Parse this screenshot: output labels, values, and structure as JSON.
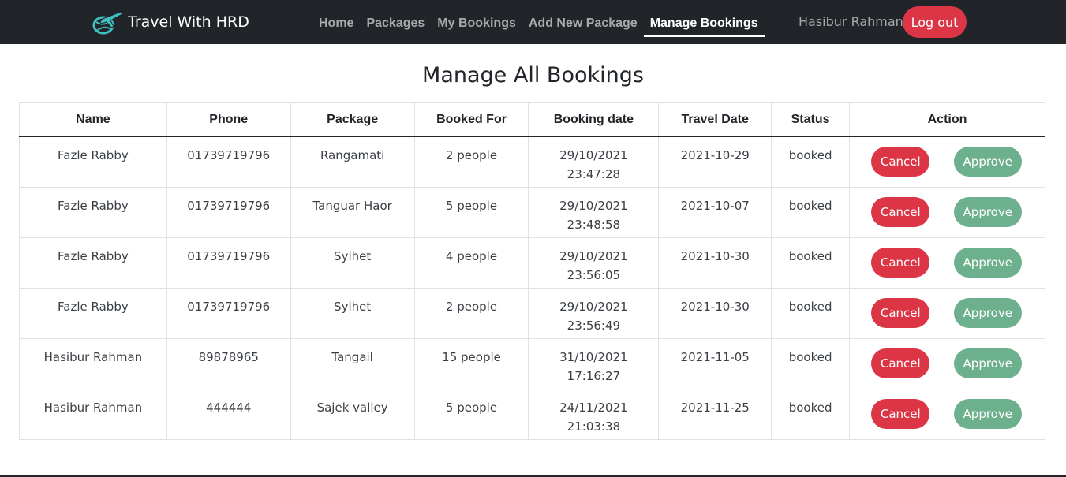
{
  "navbar": {
    "brand": "Travel With HRD",
    "links": [
      {
        "label": "Home"
      },
      {
        "label": "Packages"
      },
      {
        "label": "My Bookings"
      },
      {
        "label": "Add New Package"
      },
      {
        "label": "Manage Bookings",
        "active": true
      }
    ],
    "user_name": "Hasibur Rahman",
    "logout_label": "Log out"
  },
  "page": {
    "title": "Manage All Bookings"
  },
  "table": {
    "headers": [
      "Name",
      "Phone",
      "Package",
      "Booked For",
      "Booking date",
      "Travel Date",
      "Status",
      "Action"
    ],
    "cancel_label": "Cancel",
    "approve_label": "Approve",
    "rows": [
      {
        "name": "Fazle Rabby",
        "phone": "01739719796",
        "package": "Rangamati",
        "booked_for": "2 people",
        "booking_date": "29/10/2021",
        "booking_time": "23:47:28",
        "travel_date": "2021-10-29",
        "status": "booked"
      },
      {
        "name": "Fazle Rabby",
        "phone": "01739719796",
        "package": "Tanguar Haor",
        "booked_for": "5 people",
        "booking_date": "29/10/2021",
        "booking_time": "23:48:58",
        "travel_date": "2021-10-07",
        "status": "booked"
      },
      {
        "name": "Fazle Rabby",
        "phone": "01739719796",
        "package": "Sylhet",
        "booked_for": "4 people",
        "booking_date": "29/10/2021",
        "booking_time": "23:56:05",
        "travel_date": "2021-10-30",
        "status": "booked"
      },
      {
        "name": "Fazle Rabby",
        "phone": "01739719796",
        "package": "Sylhet",
        "booked_for": "2 people",
        "booking_date": "29/10/2021",
        "booking_time": "23:56:49",
        "travel_date": "2021-10-30",
        "status": "booked"
      },
      {
        "name": "Hasibur Rahman",
        "phone": "89878965",
        "package": "Tangail",
        "booked_for": "15 people",
        "booking_date": "31/10/2021",
        "booking_time": "17:16:27",
        "travel_date": "2021-11-05",
        "status": "booked"
      },
      {
        "name": "Hasibur Rahman",
        "phone": "444444",
        "package": "Sajek valley",
        "booked_for": "5 people",
        "booking_date": "24/11/2021",
        "booking_time": "21:03:38",
        "travel_date": "2021-11-25",
        "status": "booked"
      }
    ]
  },
  "colors": {
    "navbar_bg": "#212529",
    "cancel": "#dc3545",
    "approve": "#6db08d",
    "logo": "#3fbfc0"
  },
  "icons": {
    "brand": "airplane-globe-icon"
  }
}
